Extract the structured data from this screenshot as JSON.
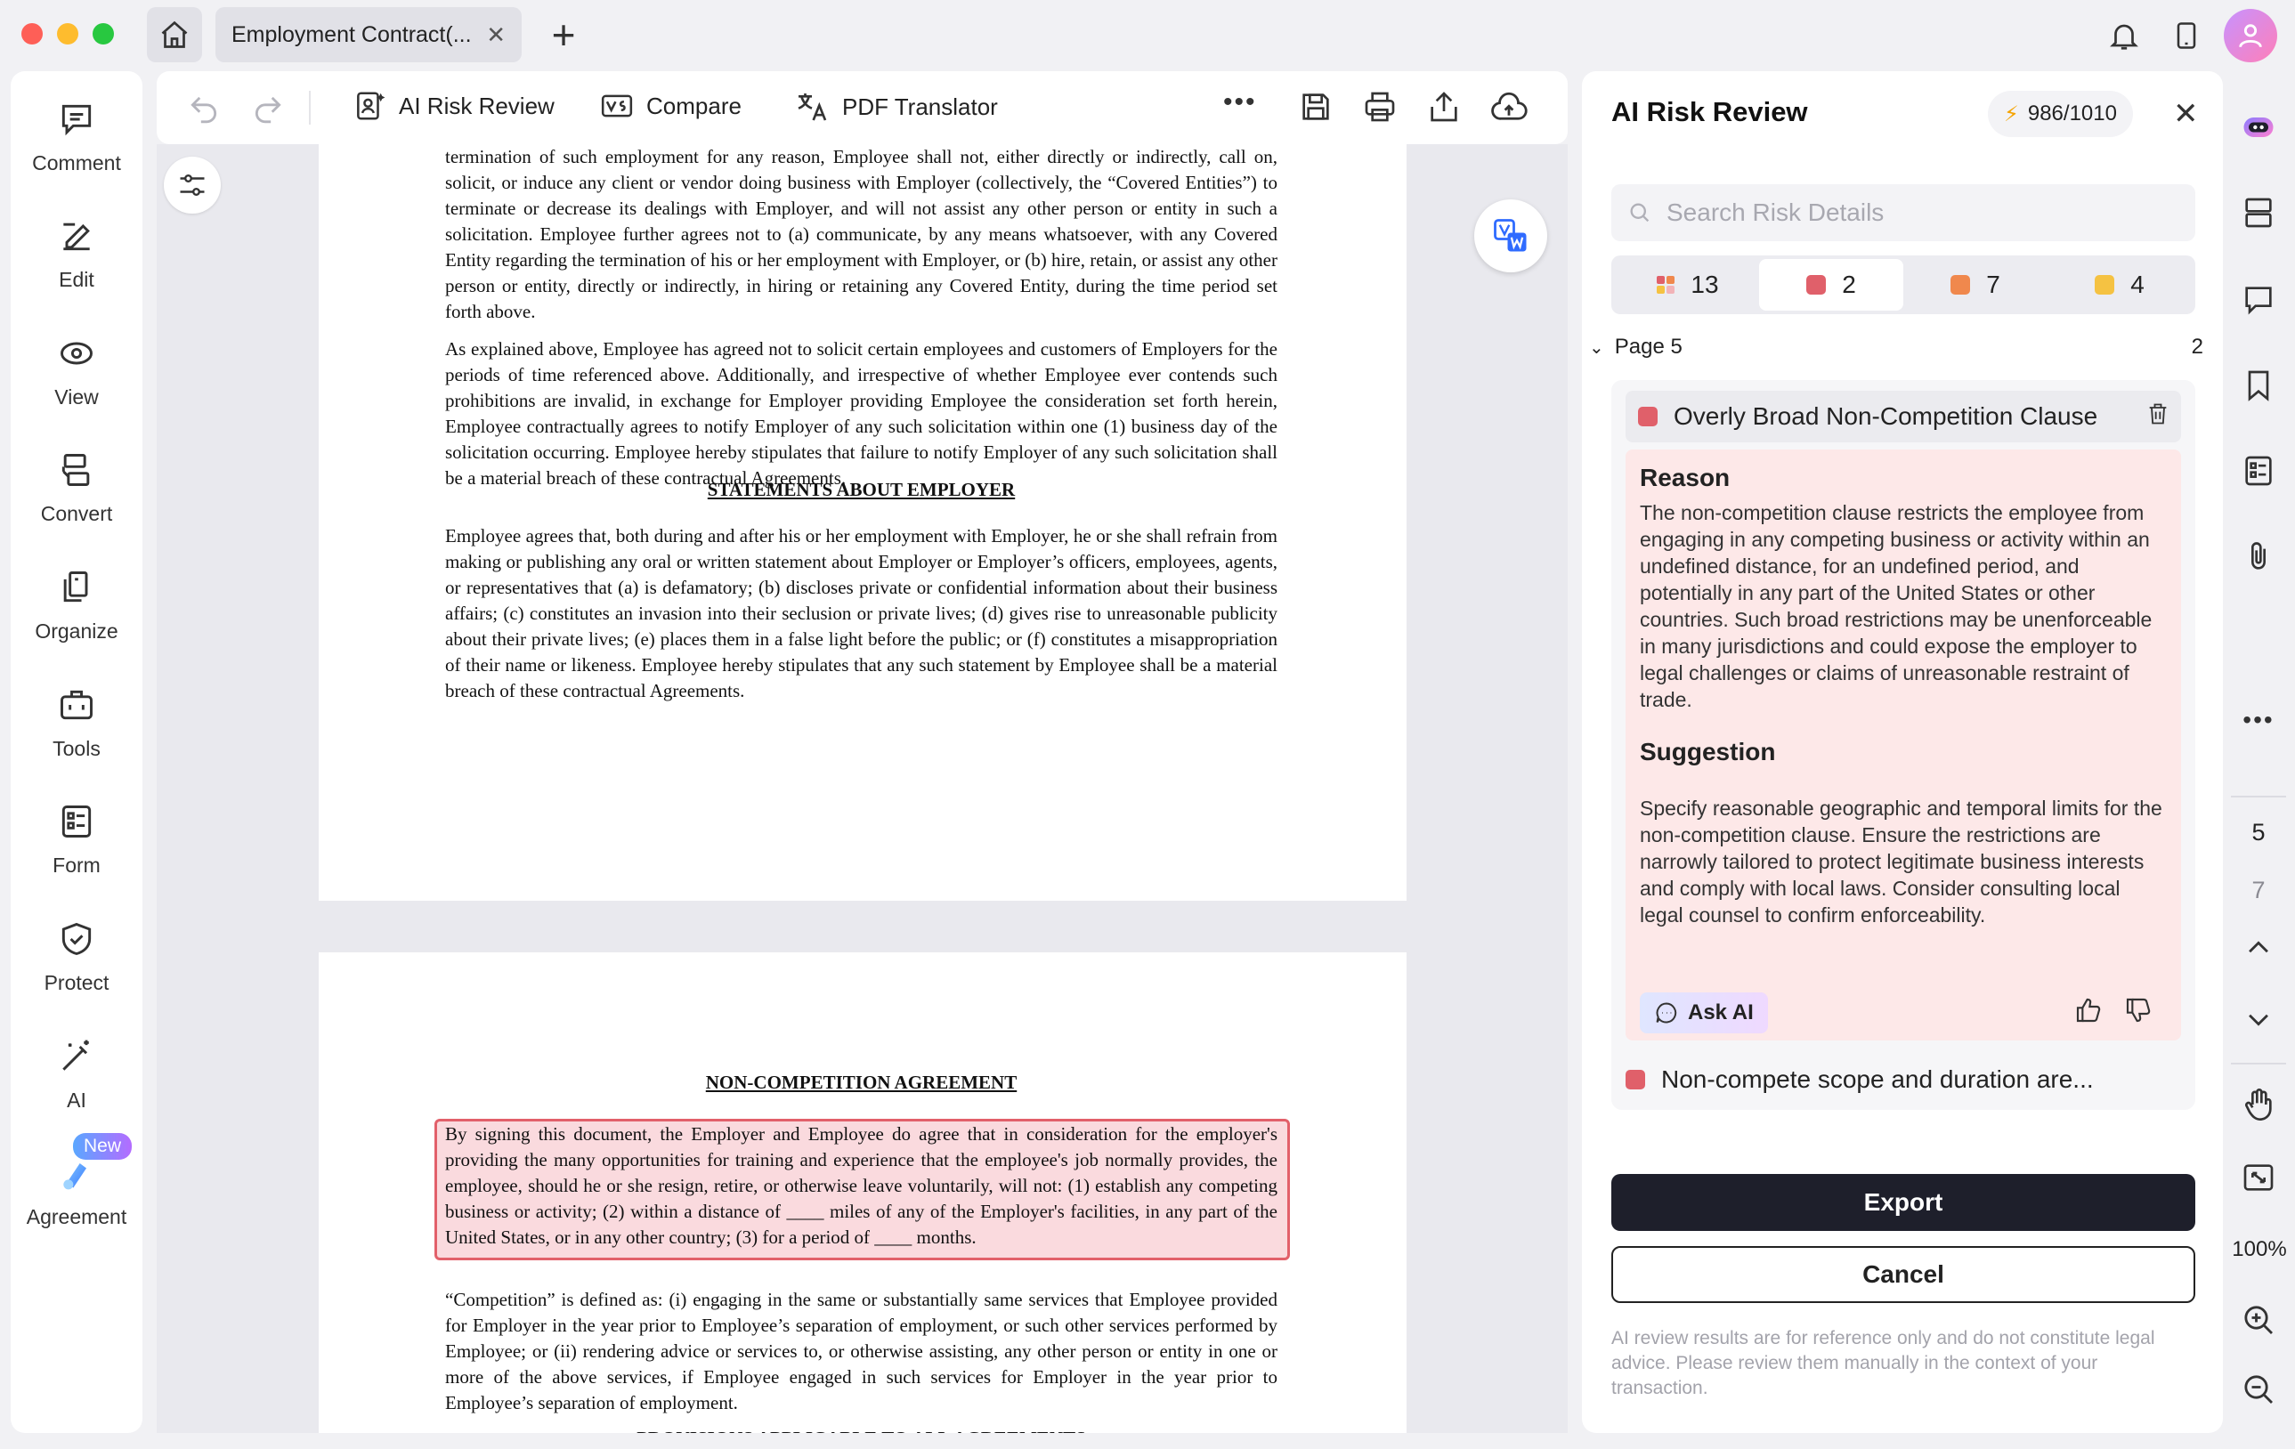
{
  "titlebar": {
    "tab_title": "Employment Contract(...",
    "tab_close": "✕",
    "new_tab": "+"
  },
  "sidebar": {
    "items": [
      {
        "label": "Comment",
        "icon": "comment-icon"
      },
      {
        "label": "Edit",
        "icon": "edit-icon"
      },
      {
        "label": "View",
        "icon": "view-icon"
      },
      {
        "label": "Convert",
        "icon": "convert-icon"
      },
      {
        "label": "Organize",
        "icon": "organize-icon"
      },
      {
        "label": "Tools",
        "icon": "tools-icon"
      },
      {
        "label": "Form",
        "icon": "form-icon"
      },
      {
        "label": "Protect",
        "icon": "protect-icon"
      },
      {
        "label": "AI",
        "icon": "ai-wand-icon"
      },
      {
        "label": "Agreement",
        "icon": "agreement-icon"
      }
    ],
    "new_badge": "New",
    "more": "•••"
  },
  "toolbar": {
    "ai_risk_review": "AI Risk Review",
    "compare": "Compare",
    "pdf_translator": "PDF Translator",
    "more": "•••"
  },
  "document": {
    "page1": {
      "p1": "termination of such employment for any reason, Employee shall not, either directly or indirectly, call on, solicit, or induce any client or vendor doing business with Employer (collectively, the “Covered Entities”) to terminate or decrease its dealings with Employer, and will not assist any other person or entity in such a solicitation.  Employee further agrees not to (a) communicate, by any means whatsoever, with any Covered Entity regarding the termination of his or her employment with Employer, or (b) hire, retain, or assist any other person or entity, directly or indirectly, in hiring or retaining any Covered Entity, during the time period set forth above.",
      "p2": "As explained above, Employee has agreed not to solicit certain employees and customers of Employers for the periods of time referenced above.  Additionally, and irrespective of whether Employee ever contends such prohibitions are invalid, in exchange for Employer providing Employee the consideration set forth herein, Employee contractually agrees to notify Employer of any such solicitation within one (1) business day of the solicitation occurring.  Employee hereby stipulates that failure to notify Employer of any such solicitation shall be a material breach of these contractual Agreements.",
      "heading": "STATEMENTS ABOUT EMPLOYER",
      "p3": "Employee agrees that, both during and after his or her employment with Employer, he or she shall refrain from making or publishing any oral or written statement about Employer or Employer’s officers, employees, agents, or representatives that (a) is defamatory; (b) discloses private or confidential information about their business affairs; (c) constitutes an invasion into their seclusion or private lives; (d) gives rise to unreasonable publicity about their private lives; (e) places them in a false light before the public; or (f) constitutes a misappropriation of their name or likeness.  Employee hereby stipulates that any such statement by Employee shall be a material breach of these contractual Agreements."
    },
    "page2": {
      "heading": "NON-COMPETITION AGREEMENT",
      "highlight": "By signing this document, the Employer and Employee do agree that in consideration for the employer's providing the many opportunities for training and experience that the employee's job normally provides, the employee, should he or she resign, retire, or otherwise leave voluntarily, will not: (1) establish any competing business or activity; (2) within a distance of ____ miles of any of the Employer's facilities, in any part of the United States, or in any other country; (3) for a period of ____ months.",
      "p2": "“Competition” is defined as: (i) engaging in the same or substantially same services that Employee provided for Employer in the year prior to Employee’s separation of employment, or such other services performed by Employee; or (ii) rendering advice or services to, or otherwise assisting, any other person or entity in one or more of the above services, if Employee engaged in such services for Employer in the year prior to Employee’s separation of employment.",
      "next_heading": "PROVISIONS APPLICABLE TO ALL AGREEMENTS"
    }
  },
  "panel": {
    "title": "AI Risk Review",
    "credits": "986/1010",
    "close": "✕",
    "search_placeholder": "Search Risk Details",
    "filters": [
      {
        "count": "13",
        "color": "multi"
      },
      {
        "count": "2",
        "color": "#e0606a"
      },
      {
        "count": "7",
        "color": "#f0884d"
      },
      {
        "count": "4",
        "color": "#f5c242"
      }
    ],
    "page_group": {
      "label": "Page 5",
      "count": "2"
    },
    "risk": {
      "title": "Overly Broad Non-Competition Clause",
      "reason_heading": "Reason",
      "reason_text": "The non-competition clause restricts the employee from engaging in any competing business or activity within an undefined distance, for an undefined period, and potentially in any part of the United States or other countries. Such broad restrictions may be unenforceable in many jurisdictions and could expose the employer to legal challenges or claims of unreasonable restraint of trade.",
      "suggestion_heading": "Suggestion",
      "suggestion_text": "Specify reasonable geographic and temporal limits for the non-competition clause. Ensure the restrictions are narrowly tailored to protect legitimate business interests and comply with local laws. Consider consulting local legal counsel to confirm enforceability.",
      "ask_ai": "Ask AI"
    },
    "risk2_title": "Non-compete scope and duration are...",
    "export": "Export",
    "cancel": "Cancel",
    "disclaimer": "AI review results are for reference only and do not constitute legal advice. Please review them manually in the context of your transaction."
  },
  "rail": {
    "current_page": "5",
    "total_pages": "7",
    "zoom": "100%",
    "more": "•••"
  },
  "colors": {
    "accent_red": "#e0606a",
    "accent_orange": "#f0884d",
    "accent_yellow": "#f5c242",
    "dark_button": "#1e1f2b"
  }
}
